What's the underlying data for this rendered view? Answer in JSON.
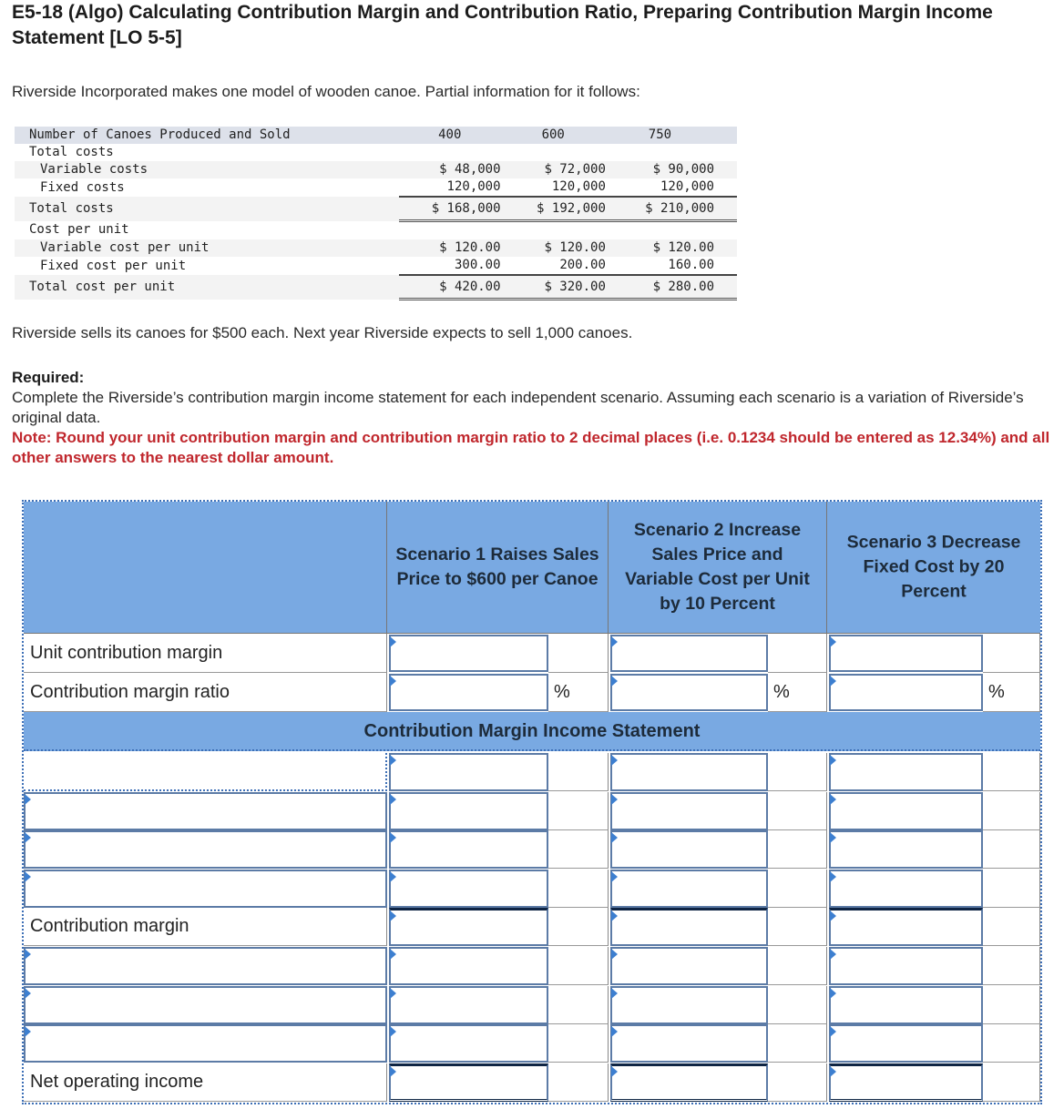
{
  "title": "E5-18 (Algo) Calculating Contribution Margin and Contribution Ratio, Preparing Contribution Margin Income Statement [LO 5-5]",
  "intro": "Riverside Incorporated makes one model of wooden canoe. Partial information for it follows:",
  "data_table": {
    "header": {
      "label": "Number of Canoes Produced and Sold",
      "values": [
        "400",
        "600",
        "750"
      ]
    },
    "rows": [
      {
        "label": "Total costs",
        "values": [
          "",
          "",
          ""
        ]
      },
      {
        "label": "Variable costs",
        "values": [
          "$ 48,000",
          "$ 72,000",
          "$ 90,000"
        ]
      },
      {
        "label": "Fixed costs",
        "values": [
          "120,000",
          "120,000",
          "120,000"
        ]
      },
      {
        "label": "Total costs",
        "values": [
          "$ 168,000",
          "$ 192,000",
          "$ 210,000"
        ]
      },
      {
        "label": "Cost per unit",
        "values": [
          "",
          "",
          ""
        ]
      },
      {
        "label": "Variable cost per unit",
        "values": [
          "$ 120.00",
          "$ 120.00",
          "$ 120.00"
        ]
      },
      {
        "label": "Fixed cost per unit",
        "values": [
          "300.00",
          "200.00",
          "160.00"
        ]
      },
      {
        "label": "Total cost per unit",
        "values": [
          "$ 420.00",
          "$ 320.00",
          "$ 280.00"
        ]
      }
    ]
  },
  "sells_text": "Riverside sells its canoes for $500 each. Next year Riverside expects to sell 1,000 canoes.",
  "required": {
    "heading": "Required:",
    "text": "Complete the Riverside’s contribution margin income statement for each independent scenario. Assuming each scenario is a variation of Riverside’s original data.",
    "note": "Note: Round your unit contribution margin and contribution margin ratio to 2 decimal places (i.e. 0.1234 should be entered as 12.34%) and all other answers to the nearest dollar amount."
  },
  "answer_grid": {
    "scenarios": [
      "Scenario 1 Raises Sales Price to $600 per Canoe",
      "Scenario 2 Increase Sales Price and Variable Cost per Unit by 10 Percent",
      "Scenario 3 Decrease Fixed Cost by 20 Percent"
    ],
    "top_rows": [
      {
        "label": "Unit contribution margin",
        "suffix": ""
      },
      {
        "label": "Contribution margin ratio",
        "suffix": "%"
      }
    ],
    "section_title": "Contribution Margin Income Statement",
    "statement_rows": [
      {
        "label": "",
        "editable_label": true
      },
      {
        "label": "",
        "editable_label": true
      },
      {
        "label": "",
        "editable_label": true
      },
      {
        "label": "",
        "editable_label": true
      },
      {
        "label": "Contribution margin",
        "editable_label": false
      },
      {
        "label": "",
        "editable_label": true
      },
      {
        "label": "",
        "editable_label": true
      },
      {
        "label": "",
        "editable_label": true
      },
      {
        "label": "Net operating income",
        "editable_label": false
      }
    ],
    "input_values": ""
  }
}
